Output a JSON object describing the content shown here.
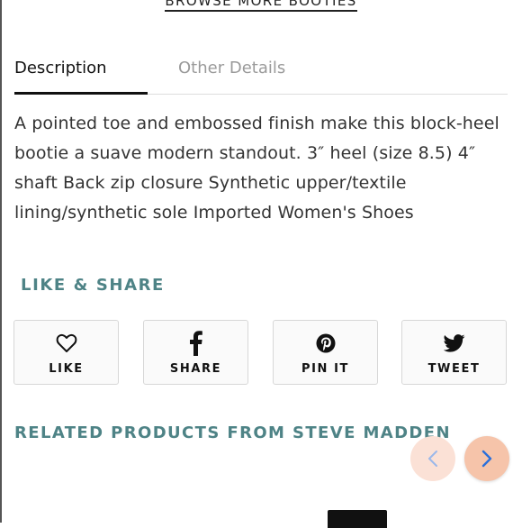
{
  "browse_link": "BROWSE MORE BOOTIES",
  "tabs": [
    {
      "label": "Description",
      "active": true
    },
    {
      "label": "Other Details",
      "active": false
    }
  ],
  "description": "A pointed toe and embossed finish make this block-heel bootie a suave modern standout. 3″ heel (size 8.5) 4″ shaft Back zip closure Synthetic upper/textile lining/synthetic sole Imported Women's Shoes",
  "share": {
    "heading": "LIKE & SHARE",
    "buttons": [
      {
        "label": "LIKE",
        "icon": "heart-icon"
      },
      {
        "label": "SHARE",
        "icon": "facebook-icon"
      },
      {
        "label": "PIN IT",
        "icon": "pinterest-icon"
      },
      {
        "label": "TWEET",
        "icon": "twitter-icon"
      }
    ]
  },
  "related": {
    "heading": "RELATED PRODUCTS FROM STEVE MADDEN",
    "prev_icon": "chevron-left-icon",
    "next_icon": "chevron-right-icon"
  },
  "colors": {
    "accent_teal": "#4e8386",
    "carousel_prev_bg": "#fbe1d6",
    "carousel_next_bg": "#f6c4aa",
    "chevron_blue": "#2a6fdb"
  }
}
